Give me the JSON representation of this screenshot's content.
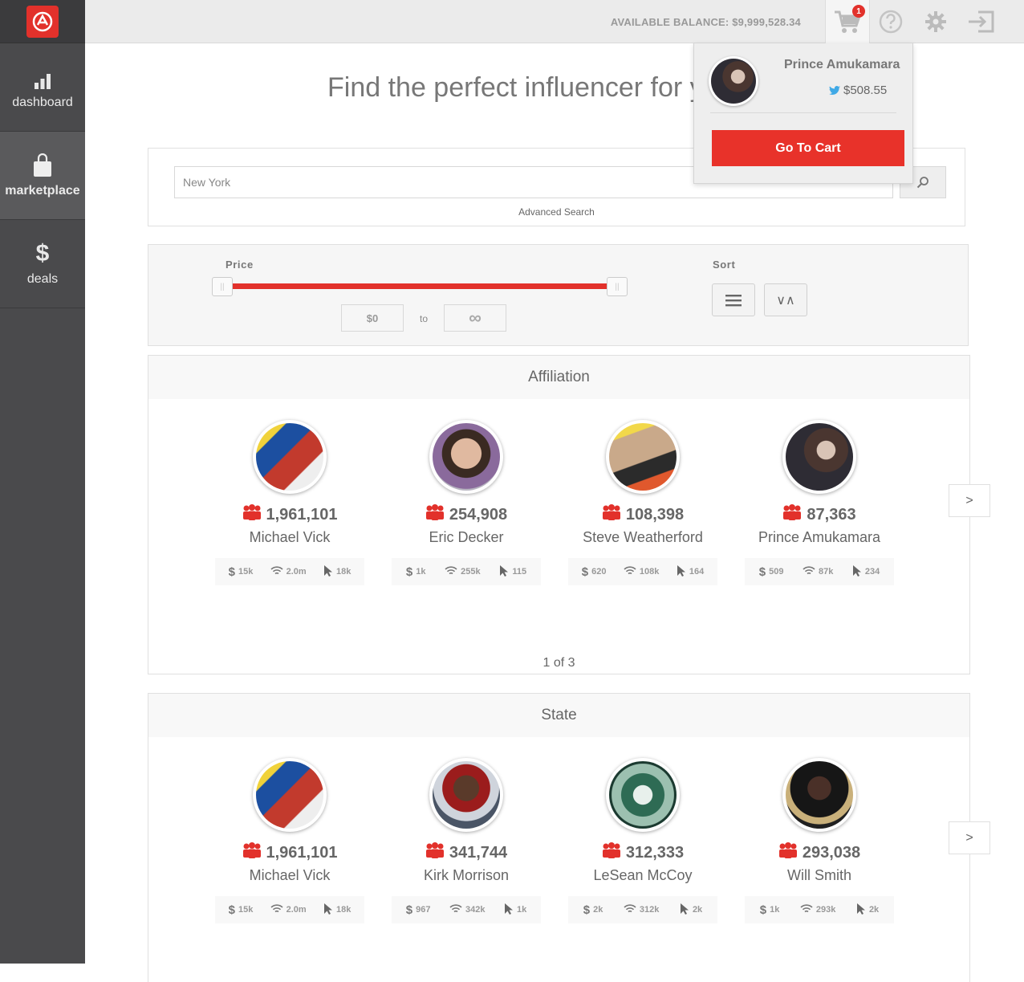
{
  "topbar": {
    "balance_label": "AVAILABLE BALANCE:",
    "balance_value": "$9,999,528.34",
    "cart_count": "1"
  },
  "sidebar": {
    "items": [
      {
        "label": "dashboard",
        "icon": "bar-chart-icon"
      },
      {
        "label": "marketplace",
        "icon": "shopping-bag-icon"
      },
      {
        "label": "deals",
        "icon": "dollar-icon"
      }
    ]
  },
  "cart": {
    "name": "Prince Amukamara",
    "price": "$508.55",
    "button": "Go To Cart"
  },
  "main": {
    "headline": "Find the perfect influencer for you",
    "search_value": "New York",
    "advanced_search": "Advanced Search"
  },
  "filters": {
    "price_label": "Price",
    "sort_label": "Sort",
    "min_price": "$0",
    "to": "to",
    "max_price": "∞",
    "sort_order": "∨∧"
  },
  "sections": [
    {
      "title": "Affiliation",
      "pager": "1 of 3",
      "next": ">",
      "cards": [
        {
          "followers": "1,961,101",
          "name": "Michael Vick",
          "price": "15k",
          "reach": "2.0m",
          "clicks": "18k"
        },
        {
          "followers": "254,908",
          "name": "Eric Decker",
          "price": "1k",
          "reach": "255k",
          "clicks": "115"
        },
        {
          "followers": "108,398",
          "name": "Steve Weatherford",
          "price": "620",
          "reach": "108k",
          "clicks": "164"
        },
        {
          "followers": "87,363",
          "name": "Prince Amukamara",
          "price": "509",
          "reach": "87k",
          "clicks": "234"
        }
      ]
    },
    {
      "title": "State",
      "next": ">",
      "cards": [
        {
          "followers": "1,961,101",
          "name": "Michael Vick",
          "price": "15k",
          "reach": "2.0m",
          "clicks": "18k"
        },
        {
          "followers": "341,744",
          "name": "Kirk Morrison",
          "price": "967",
          "reach": "342k",
          "clicks": "1k"
        },
        {
          "followers": "312,333",
          "name": "LeSean McCoy",
          "price": "2k",
          "reach": "312k",
          "clicks": "2k"
        },
        {
          "followers": "293,038",
          "name": "Will Smith",
          "price": "1k",
          "reach": "293k",
          "clicks": "2k"
        }
      ]
    }
  ],
  "colors": {
    "accent": "#e2312b",
    "sidebar": "#4a4a4c",
    "topbar": "#ebebeb"
  }
}
